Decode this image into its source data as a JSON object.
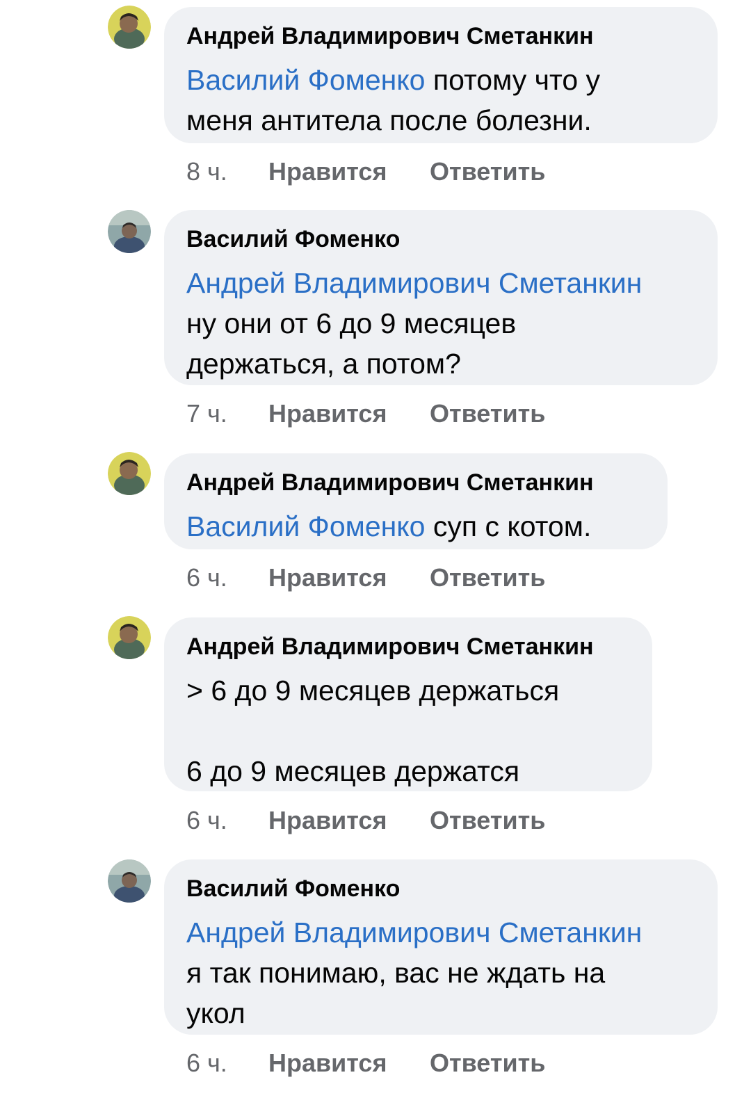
{
  "comments": [
    {
      "author": "Андрей Владимирович Сметанкин",
      "avatar": "avatar-andrey-icon",
      "lines": [
        {
          "mention": "Василий Фоменко",
          "text": " потому что у"
        },
        {
          "mention": "",
          "text": "меня антитела после болезни."
        }
      ],
      "time": "8 ч.",
      "like_label": "Нравится",
      "reply_label": "Ответить"
    },
    {
      "author": "Василий Фоменко",
      "avatar": "avatar-vasily-icon",
      "lines": [
        {
          "mention": "Андрей Владимирович Сметанкин",
          "text": ""
        },
        {
          "mention": "",
          "text": "ну они от 6 до 9 месяцев"
        },
        {
          "mention": "",
          "text": "держаться, а потом?"
        }
      ],
      "time": "7 ч.",
      "like_label": "Нравится",
      "reply_label": "Ответить"
    },
    {
      "author": "Андрей Владимирович Сметанкин",
      "avatar": "avatar-andrey-icon",
      "lines": [
        {
          "mention": "Василий Фоменко",
          "text": " суп с котом."
        }
      ],
      "time": "6 ч.",
      "like_label": "Нравится",
      "reply_label": "Ответить"
    },
    {
      "author": "Андрей Владимирович Сметанкин",
      "avatar": "avatar-andrey-icon",
      "lines": [
        {
          "mention": "",
          "text": "> 6 до 9 месяцев держаться"
        },
        {
          "mention": "",
          "text": ""
        },
        {
          "mention": "",
          "text": "6 до 9 месяцев держатся"
        }
      ],
      "time": "6 ч.",
      "like_label": "Нравится",
      "reply_label": "Ответить"
    },
    {
      "author": "Василий Фоменко",
      "avatar": "avatar-vasily-icon",
      "lines": [
        {
          "mention": "Андрей Владимирович Сметанкин",
          "text": ""
        },
        {
          "mention": "",
          "text": "я так понимаю, вас не ждать на"
        },
        {
          "mention": "",
          "text": "укол"
        }
      ],
      "time": "6 ч.",
      "like_label": "Нравится",
      "reply_label": "Ответить"
    }
  ],
  "colors": {
    "bubble": "#eff1f4",
    "mention": "#2a6fc6",
    "text": "#050505",
    "meta": "#65676b"
  }
}
